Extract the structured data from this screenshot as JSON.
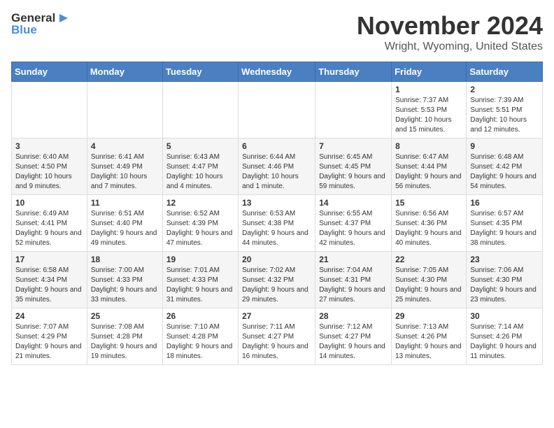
{
  "header": {
    "logo_general": "General",
    "logo_blue": "Blue",
    "month": "November 2024",
    "location": "Wright, Wyoming, United States"
  },
  "days_of_week": [
    "Sunday",
    "Monday",
    "Tuesday",
    "Wednesday",
    "Thursday",
    "Friday",
    "Saturday"
  ],
  "weeks": [
    [
      {
        "day": "",
        "info": ""
      },
      {
        "day": "",
        "info": ""
      },
      {
        "day": "",
        "info": ""
      },
      {
        "day": "",
        "info": ""
      },
      {
        "day": "",
        "info": ""
      },
      {
        "day": "1",
        "info": "Sunrise: 7:37 AM\nSunset: 5:53 PM\nDaylight: 10 hours and 15 minutes."
      },
      {
        "day": "2",
        "info": "Sunrise: 7:39 AM\nSunset: 5:51 PM\nDaylight: 10 hours and 12 minutes."
      }
    ],
    [
      {
        "day": "3",
        "info": "Sunrise: 6:40 AM\nSunset: 4:50 PM\nDaylight: 10 hours and 9 minutes."
      },
      {
        "day": "4",
        "info": "Sunrise: 6:41 AM\nSunset: 4:49 PM\nDaylight: 10 hours and 7 minutes."
      },
      {
        "day": "5",
        "info": "Sunrise: 6:43 AM\nSunset: 4:47 PM\nDaylight: 10 hours and 4 minutes."
      },
      {
        "day": "6",
        "info": "Sunrise: 6:44 AM\nSunset: 4:46 PM\nDaylight: 10 hours and 1 minute."
      },
      {
        "day": "7",
        "info": "Sunrise: 6:45 AM\nSunset: 4:45 PM\nDaylight: 9 hours and 59 minutes."
      },
      {
        "day": "8",
        "info": "Sunrise: 6:47 AM\nSunset: 4:44 PM\nDaylight: 9 hours and 56 minutes."
      },
      {
        "day": "9",
        "info": "Sunrise: 6:48 AM\nSunset: 4:42 PM\nDaylight: 9 hours and 54 minutes."
      }
    ],
    [
      {
        "day": "10",
        "info": "Sunrise: 6:49 AM\nSunset: 4:41 PM\nDaylight: 9 hours and 52 minutes."
      },
      {
        "day": "11",
        "info": "Sunrise: 6:51 AM\nSunset: 4:40 PM\nDaylight: 9 hours and 49 minutes."
      },
      {
        "day": "12",
        "info": "Sunrise: 6:52 AM\nSunset: 4:39 PM\nDaylight: 9 hours and 47 minutes."
      },
      {
        "day": "13",
        "info": "Sunrise: 6:53 AM\nSunset: 4:38 PM\nDaylight: 9 hours and 44 minutes."
      },
      {
        "day": "14",
        "info": "Sunrise: 6:55 AM\nSunset: 4:37 PM\nDaylight: 9 hours and 42 minutes."
      },
      {
        "day": "15",
        "info": "Sunrise: 6:56 AM\nSunset: 4:36 PM\nDaylight: 9 hours and 40 minutes."
      },
      {
        "day": "16",
        "info": "Sunrise: 6:57 AM\nSunset: 4:35 PM\nDaylight: 9 hours and 38 minutes."
      }
    ],
    [
      {
        "day": "17",
        "info": "Sunrise: 6:58 AM\nSunset: 4:34 PM\nDaylight: 9 hours and 35 minutes."
      },
      {
        "day": "18",
        "info": "Sunrise: 7:00 AM\nSunset: 4:33 PM\nDaylight: 9 hours and 33 minutes."
      },
      {
        "day": "19",
        "info": "Sunrise: 7:01 AM\nSunset: 4:33 PM\nDaylight: 9 hours and 31 minutes."
      },
      {
        "day": "20",
        "info": "Sunrise: 7:02 AM\nSunset: 4:32 PM\nDaylight: 9 hours and 29 minutes."
      },
      {
        "day": "21",
        "info": "Sunrise: 7:04 AM\nSunset: 4:31 PM\nDaylight: 9 hours and 27 minutes."
      },
      {
        "day": "22",
        "info": "Sunrise: 7:05 AM\nSunset: 4:30 PM\nDaylight: 9 hours and 25 minutes."
      },
      {
        "day": "23",
        "info": "Sunrise: 7:06 AM\nSunset: 4:30 PM\nDaylight: 9 hours and 23 minutes."
      }
    ],
    [
      {
        "day": "24",
        "info": "Sunrise: 7:07 AM\nSunset: 4:29 PM\nDaylight: 9 hours and 21 minutes."
      },
      {
        "day": "25",
        "info": "Sunrise: 7:08 AM\nSunset: 4:28 PM\nDaylight: 9 hours and 19 minutes."
      },
      {
        "day": "26",
        "info": "Sunrise: 7:10 AM\nSunset: 4:28 PM\nDaylight: 9 hours and 18 minutes."
      },
      {
        "day": "27",
        "info": "Sunrise: 7:11 AM\nSunset: 4:27 PM\nDaylight: 9 hours and 16 minutes."
      },
      {
        "day": "28",
        "info": "Sunrise: 7:12 AM\nSunset: 4:27 PM\nDaylight: 9 hours and 14 minutes."
      },
      {
        "day": "29",
        "info": "Sunrise: 7:13 AM\nSunset: 4:26 PM\nDaylight: 9 hours and 13 minutes."
      },
      {
        "day": "30",
        "info": "Sunrise: 7:14 AM\nSunset: 4:26 PM\nDaylight: 9 hours and 11 minutes."
      }
    ]
  ]
}
